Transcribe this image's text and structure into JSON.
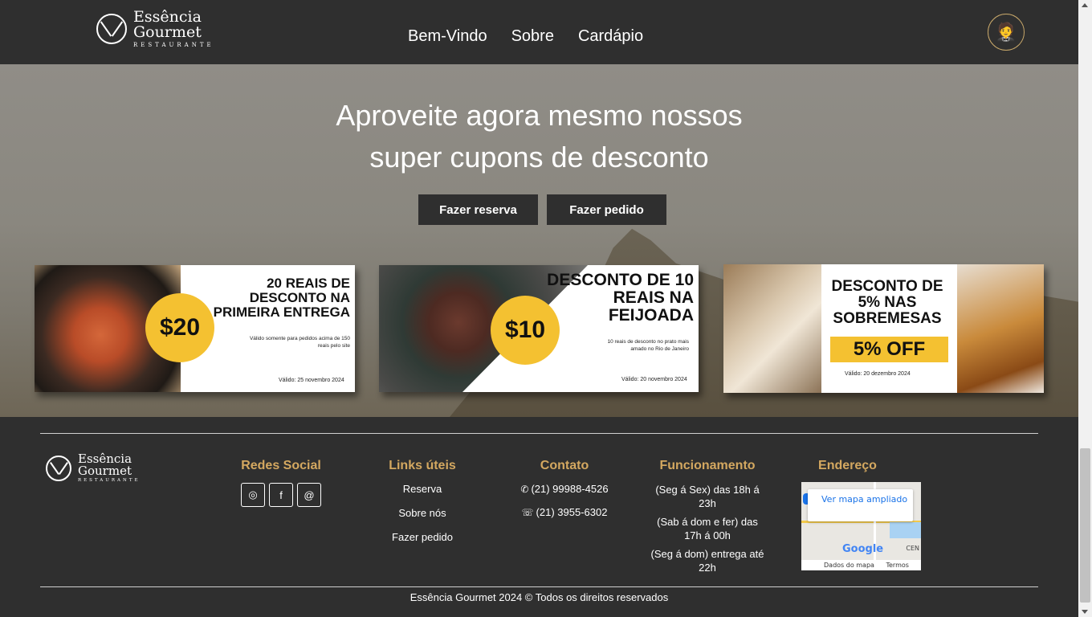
{
  "header": {
    "logo": {
      "line1": "Essência",
      "line2": "Gourmet",
      "line3": "RESTAURANTE"
    },
    "nav": [
      "Bem-Vindo",
      "Sobre",
      "Cardápio"
    ],
    "profile_icon": "waiter-icon"
  },
  "hero": {
    "title_line1": "Aproveite agora mesmo nossos",
    "title_line2": "super cupons de desconto",
    "buttons": {
      "reserva": "Fazer reserva",
      "pedido": "Fazer pedido"
    }
  },
  "coupons": [
    {
      "badge": "$20",
      "title": "20 REAIS DE DESCONTO NA PRIMEIRA ENTREGA",
      "detail": "Válido somente para pedidos acima de 150 reais pelo site",
      "valid": "Válido: 25 novembro 2024"
    },
    {
      "badge": "$10",
      "title": "DESCONTO DE 10 REAIS NA FEIJOADA",
      "detail": "10 reais de desconto no prato mais amado no Rio de Janeiro",
      "valid": "Válido: 20 novembro 2024"
    },
    {
      "title": "DESCONTO DE 5% NAS SOBREMESAS",
      "badge": "5% OFF",
      "valid": "Válido: 20 dezembro 2024"
    }
  ],
  "footer": {
    "logo": {
      "line1": "Essência",
      "line2": "Gourmet",
      "line3": "RESTAURANTE"
    },
    "social": {
      "heading": "Redes Social",
      "icons": [
        "instagram-icon",
        "facebook-icon",
        "threads-icon"
      ]
    },
    "links": {
      "heading": "Links úteis",
      "items": [
        "Reserva",
        "Sobre nós",
        "Fazer pedido"
      ]
    },
    "contato": {
      "heading": "Contato",
      "whatsapp": "(21) 99988-4526",
      "phone": "(21) 3955-6302"
    },
    "funcionamento": {
      "heading": "Funcionamento",
      "items": [
        "(Seg á Sex) das 18h á 23h",
        "(Sab á dom e fer) das 17h á 00h",
        "(Seg á dom) entrega até 22h"
      ]
    },
    "endereco": {
      "heading": "Endereço",
      "map_link": "Ver mapa ampliado",
      "map_brand": "Google",
      "map_data": "Dados do mapa",
      "map_terms": "Termos",
      "map_label_right": "CEN"
    },
    "copyright": "Essência Gourmet 2024 © Todos os direitos reservados"
  },
  "colors": {
    "accent": "#d4a860",
    "badge": "#f4c131",
    "dark": "#2f2f2f"
  }
}
